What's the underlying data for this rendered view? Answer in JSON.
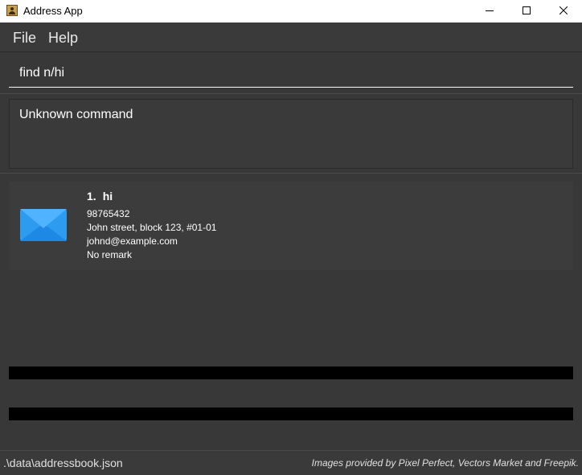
{
  "window": {
    "title": "Address App",
    "icon": "address-book-icon"
  },
  "menu": {
    "file": "File",
    "help": "Help"
  },
  "command": {
    "value": "find n/hi"
  },
  "result": {
    "text": "Unknown command"
  },
  "persons": [
    {
      "index": "1.",
      "name": "hi",
      "phone": "98765432",
      "address": "John street, block 123, #01-01",
      "email": "johnd@example.com",
      "remark": "No remark",
      "icon": "mail-envelope-icon"
    }
  ],
  "status": {
    "file_path": ".\\data\\addressbook.json",
    "credits": "Images provided by Pixel Perfect, Vectors Market and Freepik."
  },
  "colors": {
    "background": "#383838",
    "card": "#3c3c3c",
    "text": "#ffffff",
    "mail_blue": "#2d9cf0"
  }
}
